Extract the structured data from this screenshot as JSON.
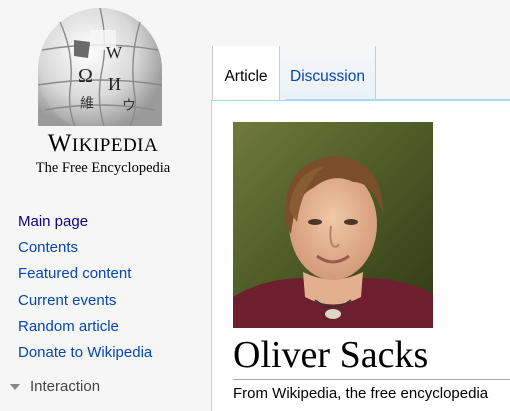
{
  "logo": {
    "wordmark": "WIKIPEDIA",
    "tagline": "The Free Encyclopedia",
    "glyphs": [
      "Ω",
      "W",
      "И",
      "維",
      "ウ"
    ]
  },
  "sidebar": {
    "items": [
      {
        "label": "Main page"
      },
      {
        "label": "Contents"
      },
      {
        "label": "Featured content"
      },
      {
        "label": "Current events"
      },
      {
        "label": "Random article"
      },
      {
        "label": "Donate to Wikipedia"
      }
    ],
    "section": {
      "label": "Interaction"
    }
  },
  "tabs": [
    {
      "label": "Article",
      "selected": true
    },
    {
      "label": "Discussion",
      "selected": false
    }
  ],
  "article": {
    "title": "Oliver Sacks",
    "subtitle": "From Wikipedia, the free encyclopedia"
  },
  "colors": {
    "link": "#0645ad",
    "visited_link": "#0b0080",
    "tab_border": "#a7d7f9",
    "sidebar_bg": "#f6f6f6"
  }
}
